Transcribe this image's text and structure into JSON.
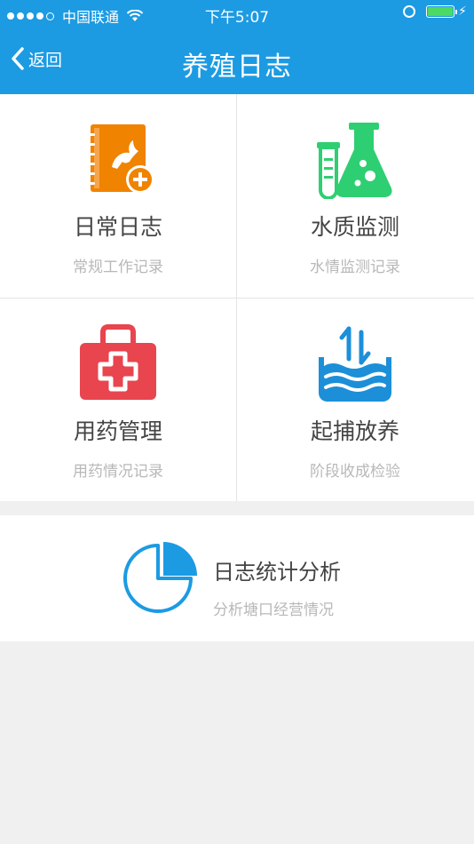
{
  "status_bar": {
    "carrier": "中国联通",
    "time": "下午5:07",
    "charging_symbol": "⚡"
  },
  "nav": {
    "back_label": "返回",
    "title": "养殖日志"
  },
  "modules": [
    {
      "name": "日常日志",
      "sub": "常规工作记录",
      "icon": "notebook-fish-add-icon",
      "color": "#f08300"
    },
    {
      "name": "水质监测",
      "sub": "水情监测记录",
      "icon": "lab-flask-icon",
      "color": "#2ecf72"
    },
    {
      "name": "用药管理",
      "sub": "用药情况记录",
      "icon": "medical-kit-icon",
      "color": "#e8454f"
    },
    {
      "name": "起捕放养",
      "sub": "阶段收成检验",
      "icon": "water-transfer-icon",
      "color": "#1c8fd8"
    }
  ],
  "stats": {
    "name": "日志统计分析",
    "sub": "分析塘口经营情况",
    "icon": "pie-chart-icon",
    "color": "#1c9be3"
  },
  "colors": {
    "header": "#1c9be3",
    "background": "#f0f0f0"
  }
}
